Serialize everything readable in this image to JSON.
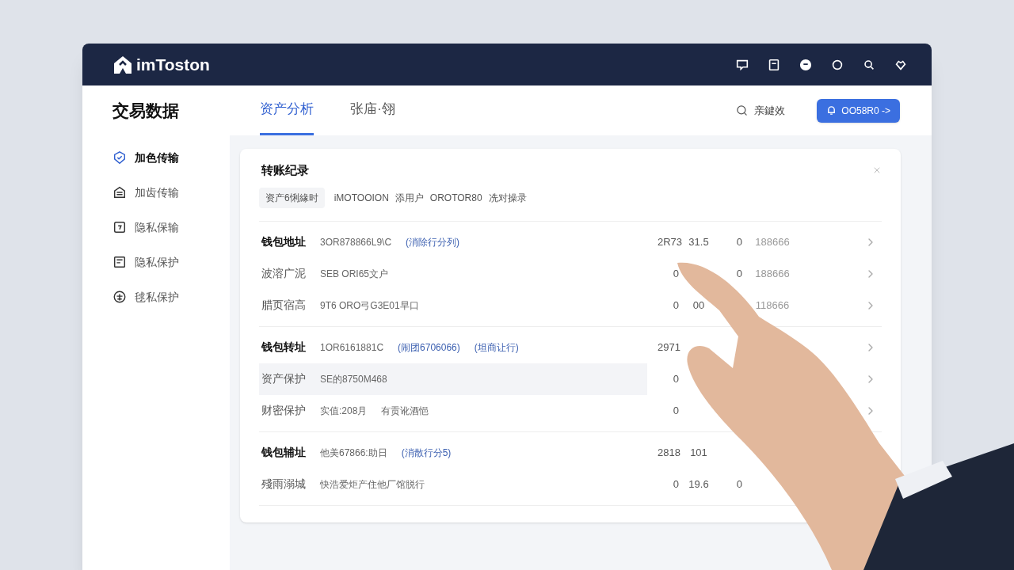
{
  "header": {
    "logo": "imToston"
  },
  "page": {
    "title": "交易数据",
    "tabs": [
      {
        "label": "资产分析",
        "selected": true
      },
      {
        "label": "张庙·翎",
        "selected": false
      }
    ],
    "search_label": "亲鍵效",
    "action_button": "OO58R0 ->"
  },
  "sidebar": {
    "items": [
      {
        "label": "加色传输",
        "selected": true
      },
      {
        "label": "加齿传输",
        "selected": false
      },
      {
        "label": "隐私保输",
        "selected": false
      },
      {
        "label": "隐私保护",
        "selected": false
      },
      {
        "label": "毬私保护",
        "selected": false
      }
    ]
  },
  "card": {
    "title": "转账纪录",
    "filters": [
      {
        "label": "资产6悧緣时",
        "kind": "chip"
      },
      {
        "label": "iMOTOOION",
        "kind": "text"
      },
      {
        "label": "添用户",
        "kind": "text"
      },
      {
        "label": "OROTOR80",
        "kind": "text"
      },
      {
        "label": "冼对操录",
        "kind": "text"
      }
    ],
    "groups": [
      {
        "rows": [
          {
            "kind": "header",
            "label": "钱包地址",
            "highlighted": false,
            "parts": [
              {
                "text": "3OR878866L9\\C",
                "kind": "text"
              },
              {
                "text": "(消除行分列)",
                "kind": "link"
              }
            ],
            "values": {
              "column_1": "2R73",
              "column_2": "31.5",
              "column_3": "0",
              "column_4": "188666"
            },
            "chevron": true
          },
          {
            "kind": "detail",
            "label": "波溶广泥",
            "highlighted": false,
            "parts": [
              {
                "text": "SEB ORI65文户",
                "kind": "text"
              }
            ],
            "values": {
              "column_1": "0",
              "column_3": "0",
              "column_4": "188666"
            },
            "chevron": true
          },
          {
            "kind": "detail",
            "label": "腊页宿高",
            "highlighted": false,
            "parts": [
              {
                "text": "9T6 ORO弓G3E01早口",
                "kind": "text"
              }
            ],
            "values": {
              "column_1": "0",
              "column_2": "00",
              "column_4": "118666"
            },
            "chevron": true
          }
        ]
      },
      {
        "rows": [
          {
            "kind": "header",
            "label": "钱包转址",
            "highlighted": false,
            "parts": [
              {
                "text": "1OR6161881C",
                "kind": "text"
              },
              {
                "text": "(闹团6706066)",
                "kind": "link"
              },
              {
                "text": "(坦商让行)",
                "kind": "link"
              }
            ],
            "values": {
              "column_1": "2971"
            },
            "chevron": true
          },
          {
            "kind": "detail",
            "label": "资产保护",
            "highlighted": true,
            "parts": [
              {
                "text": "SE的8750M468",
                "kind": "text"
              }
            ],
            "values": {
              "column_1": "0"
            },
            "chevron": true
          },
          {
            "kind": "detail",
            "label": "财密保护",
            "highlighted": false,
            "parts": [
              {
                "text": "实值:208月",
                "kind": "text"
              },
              {
                "text": "有贡讹酒悒",
                "kind": "text"
              }
            ],
            "values": {
              "column_1": "0"
            },
            "chevron": true
          }
        ]
      },
      {
        "rows": [
          {
            "kind": "header",
            "label": "钱包辅址",
            "highlighted": false,
            "parts": [
              {
                "text": "他美67866:助日",
                "kind": "text"
              },
              {
                "text": "(消散行分5)",
                "kind": "link"
              }
            ],
            "values": {
              "column_1": "2818",
              "column_2": "101"
            }
          },
          {
            "kind": "detail",
            "label": "殘雨溺城",
            "highlighted": false,
            "parts": [
              {
                "text": "快浩爱炬产住他厂馆脱行",
                "kind": "text"
              }
            ],
            "values": {
              "column_1": "0",
              "column_2": "19.6",
              "column_3": "0"
            }
          }
        ]
      }
    ]
  }
}
